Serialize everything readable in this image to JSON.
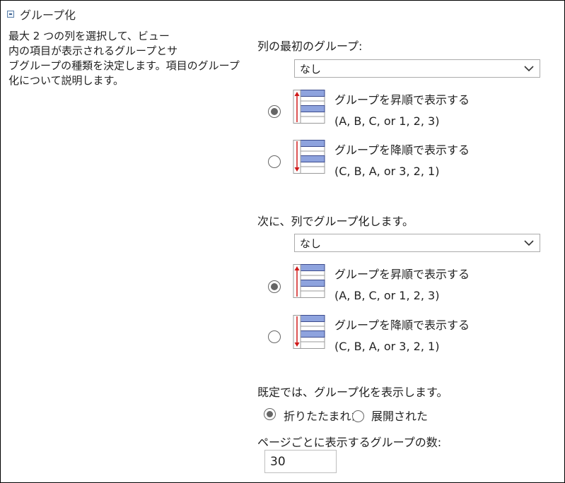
{
  "section": {
    "title": "グループ化"
  },
  "description": {
    "lines": [
      "最大 2 つの列を選択して、ビュー",
      "内の項目が表示されるグループとサ",
      "ブグループの種類を決定します。項目のグループ",
      "化について説明します。"
    ]
  },
  "first_group": {
    "label": "列の最初のグループ:",
    "select_value": "なし",
    "options": [
      {
        "title": "グループを昇順で表示する",
        "subtitle": "(A, B, C, or 1, 2, 3)",
        "checked": true,
        "icon": "sort-ascending-icon"
      },
      {
        "title": "グループを降順で表示する",
        "subtitle": "(C, B, A, or 3, 2, 1)",
        "checked": false,
        "icon": "sort-descending-icon"
      }
    ]
  },
  "second_group": {
    "label": "次に、列でグループ化します。",
    "select_value": "なし",
    "options": [
      {
        "title": "グループを昇順で表示する",
        "subtitle": "(A, B, C, or 1, 2, 3)",
        "checked": true,
        "icon": "sort-ascending-icon"
      },
      {
        "title": "グループを降順で表示する",
        "subtitle": "(C, B, A, or 3, 2, 1)",
        "checked": false,
        "icon": "sort-descending-icon"
      }
    ]
  },
  "default_display": {
    "label": "既定では、グループ化を表示します。",
    "collapsed_label": "折りたたまれた",
    "expanded_label": "展開された",
    "collapsed_checked": true
  },
  "groups_per_page": {
    "label": "ページごとに表示するグループの数:",
    "value": "30"
  },
  "colors": {
    "icon_fill": "#8ea3de",
    "icon_border": "#3c4b8c",
    "arrow": "#d01a1a"
  }
}
